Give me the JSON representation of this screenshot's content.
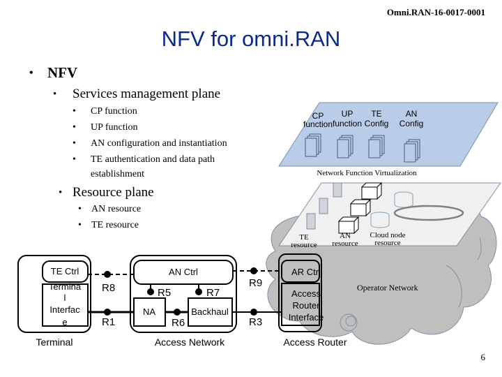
{
  "header": {
    "doc_id": "Omni.RAN-16-0017-0001",
    "title": "NFV for omni.RAN"
  },
  "outline": {
    "l1": "NFV",
    "services": {
      "label": "Services management plane",
      "items": [
        "CP function",
        "UP function",
        "AN configuration and instantiation",
        "TE authentication and data path",
        "establishment"
      ]
    },
    "resource": {
      "label": "Resource plane",
      "items": [
        "AN resource",
        "TE resource"
      ]
    }
  },
  "nfv_plane": {
    "functions": [
      {
        "l1": "CP",
        "l2": "function"
      },
      {
        "l1": "UP",
        "l2": "function"
      },
      {
        "l1": "TE",
        "l2": "Config"
      },
      {
        "l1": "AN",
        "l2": "Config"
      }
    ],
    "caption": "Network Function Virtualization",
    "color": "#b9cde8"
  },
  "resource_plane": {
    "te": {
      "l1": "TE",
      "l2": "resource"
    },
    "an": {
      "l1": "AN",
      "l2": "resource"
    },
    "cloud": {
      "l1": "Cloud node",
      "l2": "resource"
    },
    "color": "#f0f0f0"
  },
  "operator_network": {
    "label": "Operator Network",
    "color": "#bfbfbf"
  },
  "terminal": {
    "ctrl": "TE Ctrl",
    "iface": [
      "Termina",
      "l",
      "Interfac",
      "e"
    ],
    "label": "Terminal"
  },
  "access_network": {
    "ctrl": "AN Ctrl",
    "na": "NA",
    "backhaul": "Backhaul",
    "label": "Access Network"
  },
  "access_router": {
    "ctrl": "AR Ctrl",
    "iface": [
      "Access",
      "Router",
      "Interface"
    ],
    "label": "Access Router"
  },
  "ref_points": {
    "r1": "R1",
    "r3": "R3",
    "r5": "R5",
    "r6": "R6",
    "r7": "R7",
    "r8": "R8",
    "r9": "R9"
  },
  "footer": {
    "page": "6"
  }
}
